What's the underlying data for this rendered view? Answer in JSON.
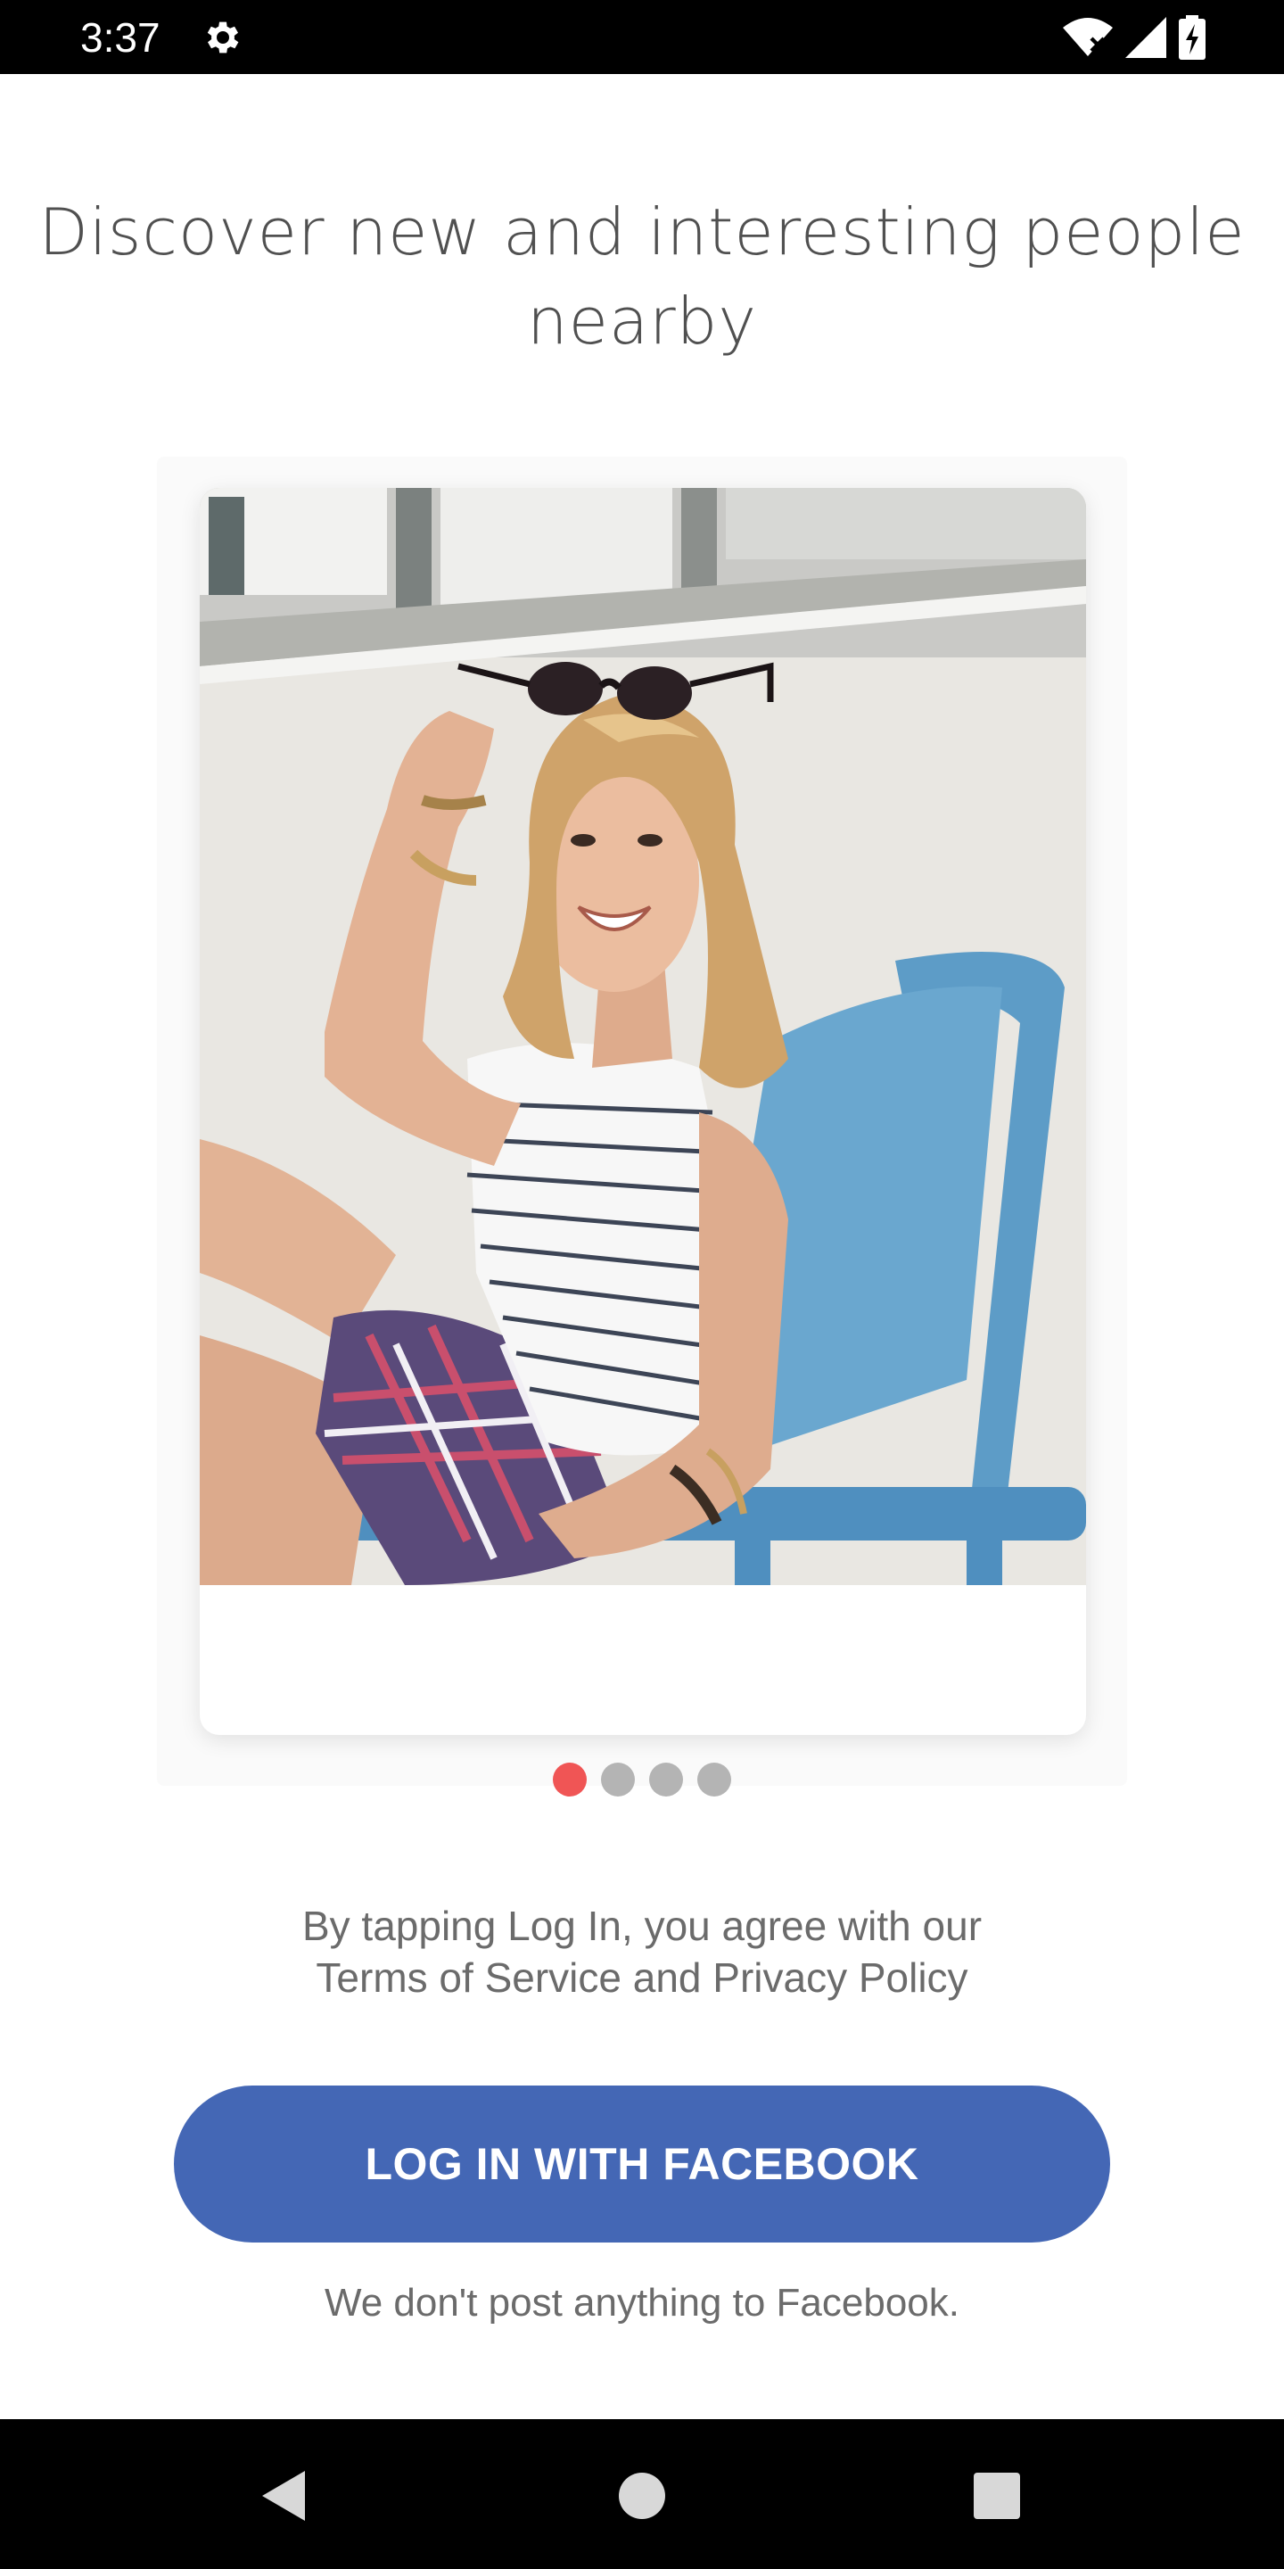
{
  "status_bar": {
    "time": "3:37",
    "icons": [
      "gear-icon",
      "wifi-icon",
      "signal-icon",
      "battery-charging-icon"
    ]
  },
  "headline": {
    "line1": "Discover new and interesting people",
    "line2": "nearby"
  },
  "carousel": {
    "dot_count": 4,
    "active_index": 0,
    "active_color": "#f05555",
    "inactive_color": "#b4b4b4"
  },
  "terms": {
    "line1": "By tapping Log In, you agree with our",
    "line2": "Terms of Service and Privacy Policy"
  },
  "login_button": {
    "label": "LOG IN WITH FACEBOOK",
    "color": "#4467b5"
  },
  "login_note": "We don't post anything to Facebook.",
  "nav_bar": {
    "icons": [
      "back-icon",
      "home-icon",
      "recents-icon"
    ]
  }
}
